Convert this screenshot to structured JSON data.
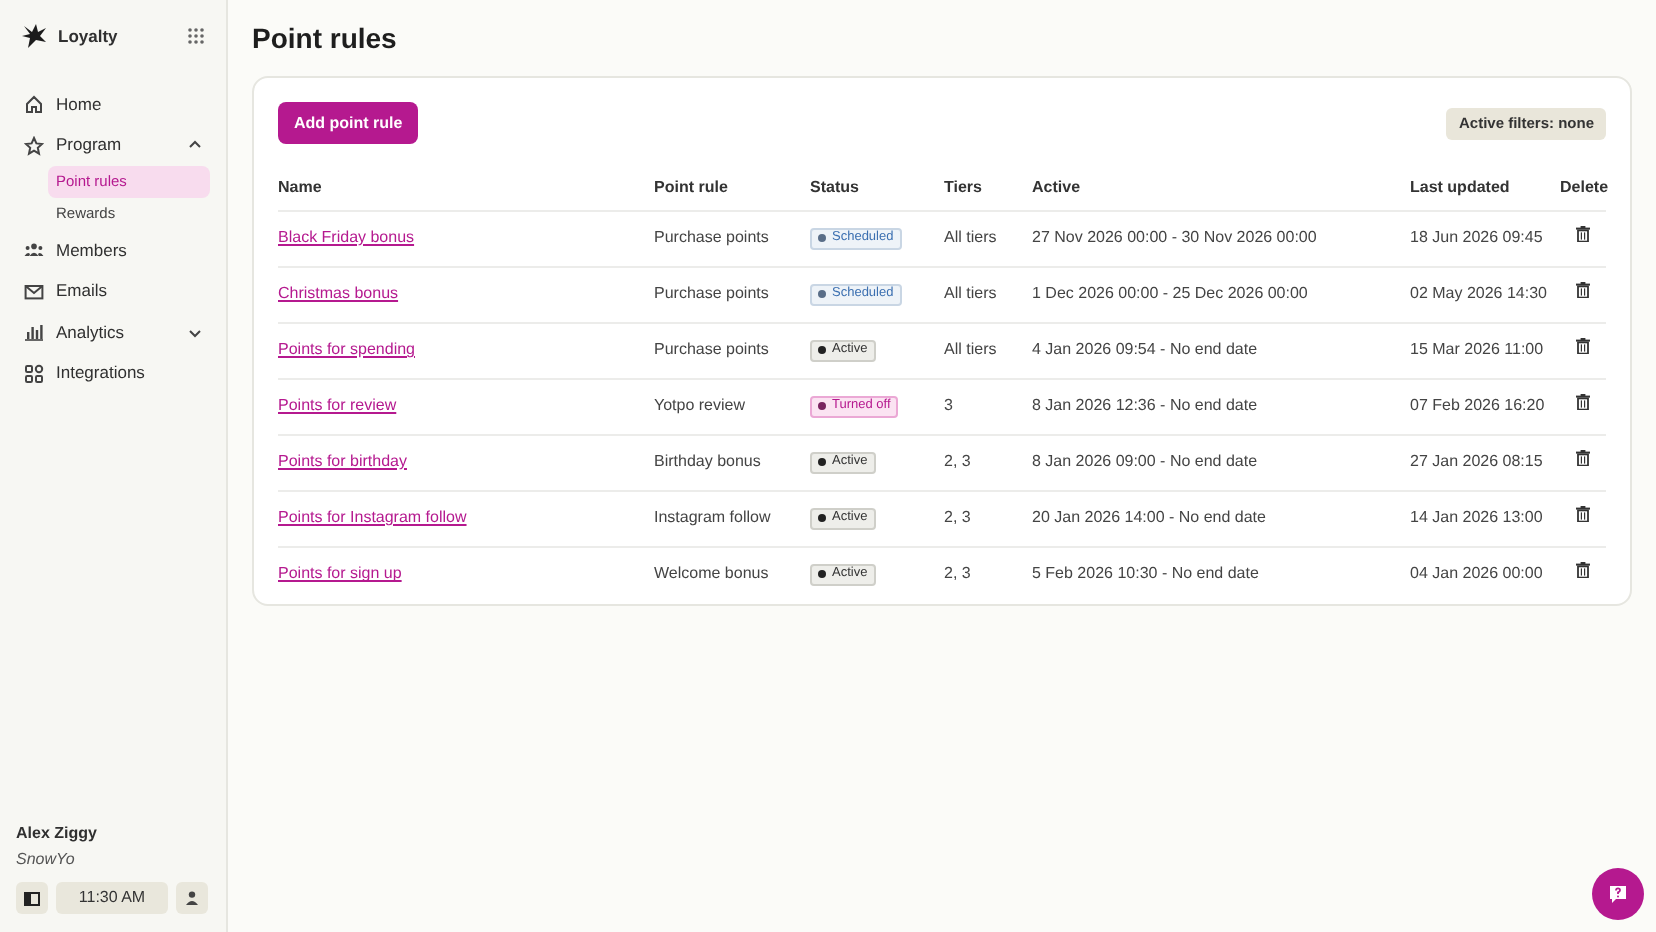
{
  "brand": {
    "name": "Loyalty"
  },
  "nav": [
    {
      "label": "Home"
    },
    {
      "label": "Program",
      "expanded": true,
      "children": [
        {
          "label": "Point rules",
          "selected": true
        },
        {
          "label": "Rewards",
          "selected": false
        }
      ]
    },
    {
      "label": "Members"
    },
    {
      "label": "Emails"
    },
    {
      "label": "Analytics",
      "expanded": false
    },
    {
      "label": "Integrations"
    }
  ],
  "user": {
    "name": "Alex Ziggy",
    "shop": "SnowYo",
    "time": "11:30 AM"
  },
  "page": {
    "title": "Point rules",
    "add_button": "Add point rule",
    "filters_button": "Active filters: none"
  },
  "table": {
    "columns": [
      "Name",
      "Point rule",
      "Status",
      "Tiers",
      "Active",
      "Last updated",
      "Delete"
    ],
    "rows": [
      {
        "name": "Black Friday bonus",
        "rule": "Purchase points",
        "status": {
          "kind": "scheduled",
          "label": "Scheduled"
        },
        "tiers": "All tiers",
        "active": "27 Nov 2026 00:00 - 30 Nov 2026 00:00",
        "updated": "18 Jun 2026 09:45"
      },
      {
        "name": "Christmas bonus",
        "rule": "Purchase points",
        "status": {
          "kind": "scheduled",
          "label": "Scheduled"
        },
        "tiers": "All tiers",
        "active": "1 Dec 2026 00:00 - 25 Dec 2026 00:00",
        "updated": "02 May 2026 14:30"
      },
      {
        "name": "Points for spending",
        "rule": "Purchase points",
        "status": {
          "kind": "active",
          "label": "Active"
        },
        "tiers": "All tiers",
        "active": "4 Jan 2026 09:54 - No end date",
        "updated": "15 Mar 2026 11:00"
      },
      {
        "name": "Points for review",
        "rule": "Yotpo review",
        "status": {
          "kind": "off",
          "label": "Turned off"
        },
        "tiers": "3",
        "active": "8 Jan 2026 12:36 - No end date",
        "updated": "07 Feb 2026 16:20"
      },
      {
        "name": "Points for birthday",
        "rule": "Birthday bonus",
        "status": {
          "kind": "active",
          "label": "Active"
        },
        "tiers": "2, 3",
        "active": "8 Jan 2026 09:00 - No end date",
        "updated": "27 Jan 2026 08:15"
      },
      {
        "name": "Points for Instagram follow",
        "rule": "Instagram follow",
        "status": {
          "kind": "active",
          "label": "Active"
        },
        "tiers": "2, 3",
        "active": "20 Jan 2026 14:00 - No end date",
        "updated": "14 Jan 2026 13:00"
      },
      {
        "name": "Points for sign up",
        "rule": "Welcome bonus",
        "status": {
          "kind": "active",
          "label": "Active"
        },
        "tiers": "2, 3",
        "active": "5 Feb 2026 10:30 - No end date",
        "updated": "04 Jan 2026 00:00"
      }
    ]
  }
}
